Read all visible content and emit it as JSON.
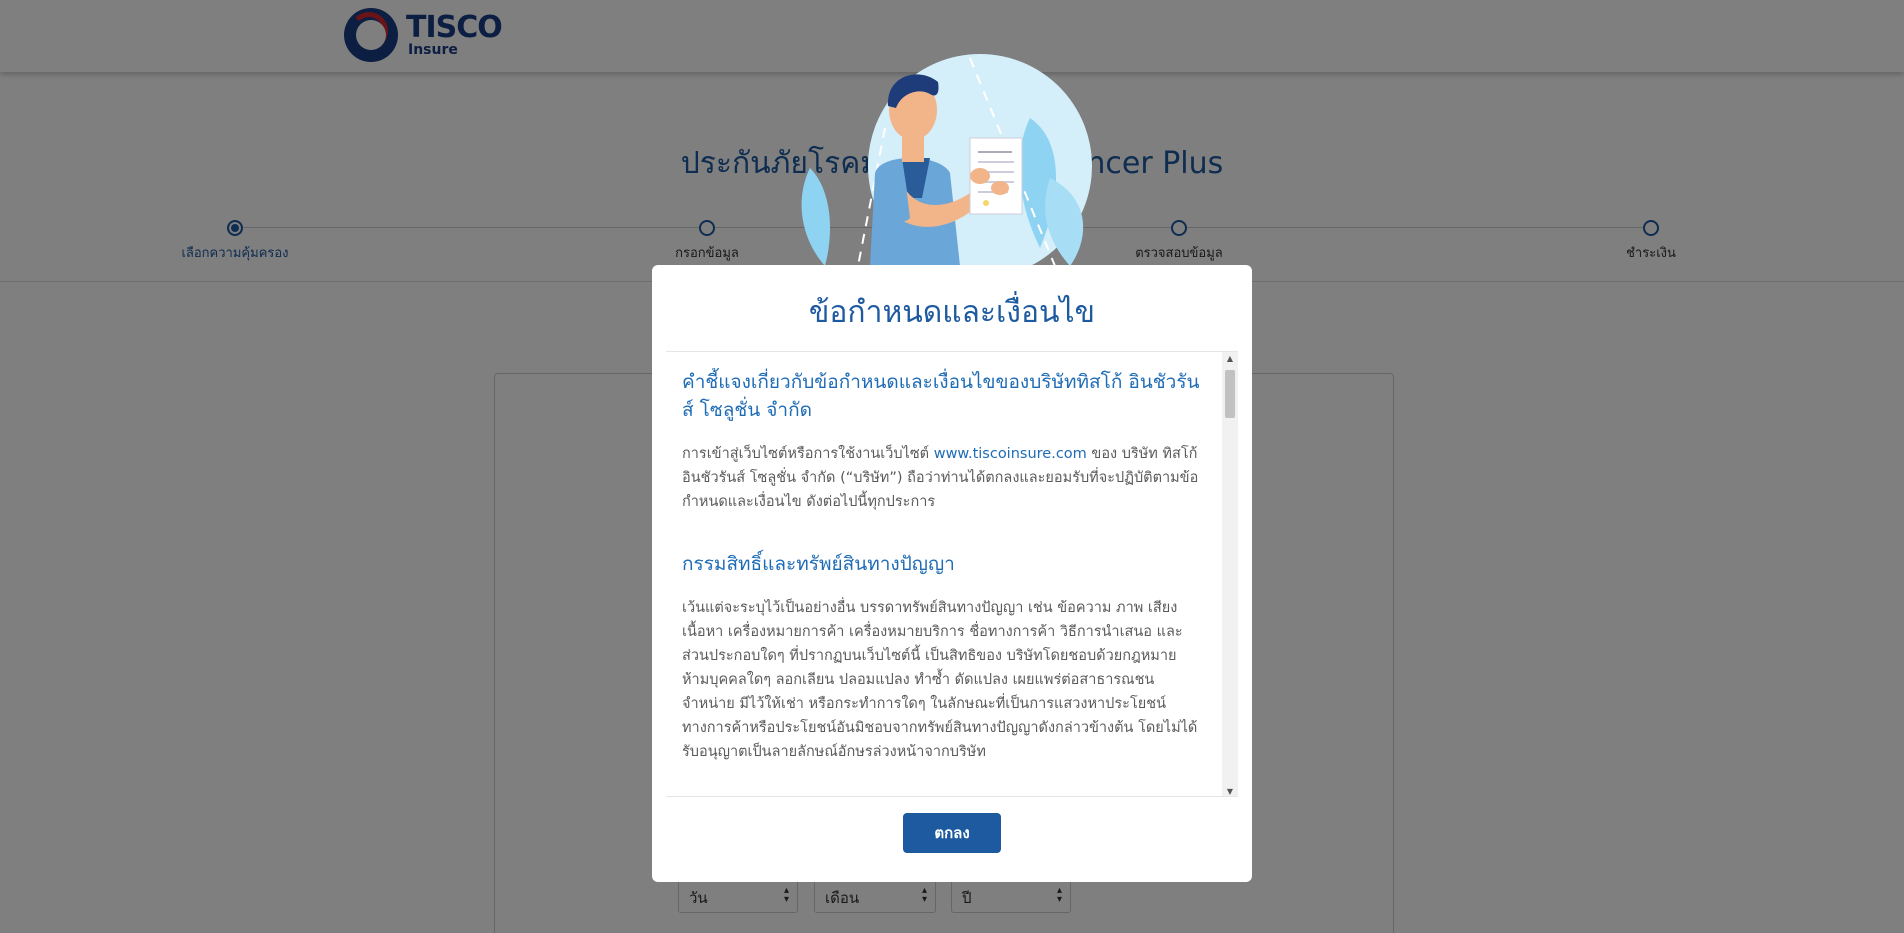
{
  "header": {
    "logo_brand": "TISCO",
    "logo_sub": "Insure"
  },
  "page_title": "ประกันภัยโรคมะเร็ง TISCO Cancer Plus",
  "stepper": {
    "steps": [
      {
        "label": "เลือกความคุ้มครอง",
        "active": true
      },
      {
        "label": "กรอกข้อมูล",
        "active": false
      },
      {
        "label": "ตรวจสอบข้อมูล",
        "active": false
      },
      {
        "label": "ชำระเงิน",
        "active": false
      }
    ]
  },
  "date_selects": {
    "day": "วัน",
    "month": "เดือน",
    "year": "ปี"
  },
  "modal": {
    "title": "ข้อกำหนดและเงื่อนไข",
    "sections": [
      {
        "heading": "คำชี้แจงเกี่ยวกับข้อกำหนดและเงื่อนไขของบริษัททิสโก้ อินชัวรันส์ โซลูชั่น จำกัด",
        "para_before": "การเข้าสู่เว็บไซต์หรือการใช้งานเว็บไซต์ ",
        "link": "www.tiscoinsure.com",
        "para_after": " ของ บริษัท ทิสโก้ อินชัวรันส์ โซลูชั่น จำกัด (“บริษัท”) ถือว่าท่านได้ตกลงและยอมรับที่จะปฏิบัติตามข้อกำหนดและเงื่อนไข ดังต่อไปนี้ทุกประการ"
      },
      {
        "heading": "กรรมสิทธิ์และทรัพย์สินทางปัญญา",
        "para": "เว้นแต่จะระบุไว้เป็นอย่างอื่น บรรดาทรัพย์สินทางปัญญา เช่น ข้อความ ภาพ เสียง เนื้อหา เครื่องหมายการค้า เครื่องหมายบริการ ชื่อทางการค้า วิธีการนำเสนอ และส่วนประกอบใดๆ ที่ปรากฏบนเว็บไซต์นี้ เป็นสิทธิของ บริษัทโดยชอบด้วยกฎหมาย ห้ามบุคคลใดๆ ลอกเลียน ปลอมแปลง ทำซ้ำ ดัดแปลง เผยแพร่ต่อสาธารณชน จำหน่าย มีไว้ให้เช่า หรือกระทำการใดๆ ในลักษณะที่เป็นการแสวงหาประโยชน์ทางการค้าหรือประโยชน์อันมิชอบจากทรัพย์สินทางปัญญาดังกล่าวข้างต้น โดยไม่ได้รับอนุญาตเป็นลายลักษณ์อักษรล่วงหน้าจากบริษัท"
      }
    ],
    "ok_label": "ตกลง"
  },
  "colors": {
    "primary": "#1e5aa0",
    "link": "#1e6cb6",
    "overlay": "rgba(0,0,0,0.5)"
  }
}
